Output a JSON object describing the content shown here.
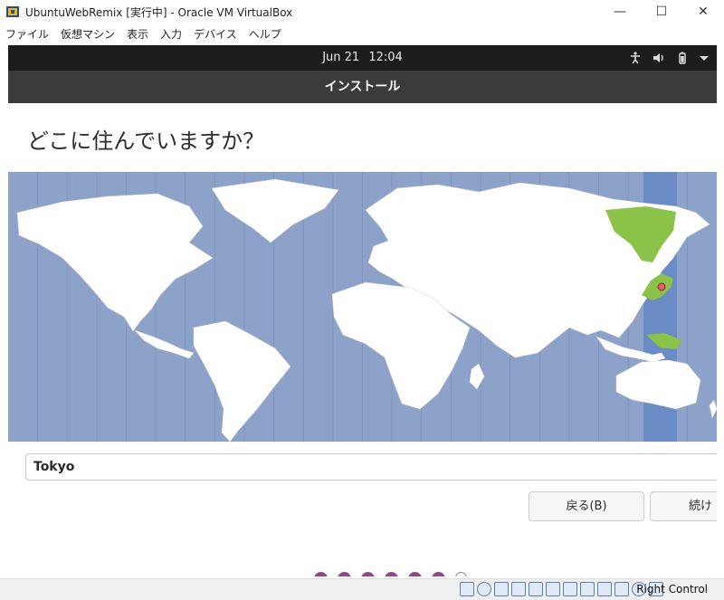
{
  "window": {
    "title": "UbuntuWebRemix [実行中] - Oracle VM VirtualBox",
    "controls": {
      "minimize": "—",
      "maximize": "☐",
      "close": "✕"
    }
  },
  "menu": {
    "items": [
      "ファイル",
      "仮想マシン",
      "表示",
      "入力",
      "デバイス",
      "ヘルプ"
    ]
  },
  "topbar": {
    "date": "Jun 21",
    "time": "12:04"
  },
  "installer": {
    "header_title": "インストール",
    "question": "どこに住んでいますか？",
    "timezone_value": "Tokyo",
    "back_label": "戻る(B)",
    "next_label": "続け",
    "progress": {
      "total_steps": 7,
      "current_step": 7
    }
  },
  "map": {
    "highlight_color": "#8bc34a",
    "timezone_band_color": "#6b8bc4",
    "ocean_color": "#8da2c9",
    "land_color": "#ffffff",
    "marker_color": "#e95a6f"
  },
  "statusbar": {
    "host_key": "Right Control"
  }
}
